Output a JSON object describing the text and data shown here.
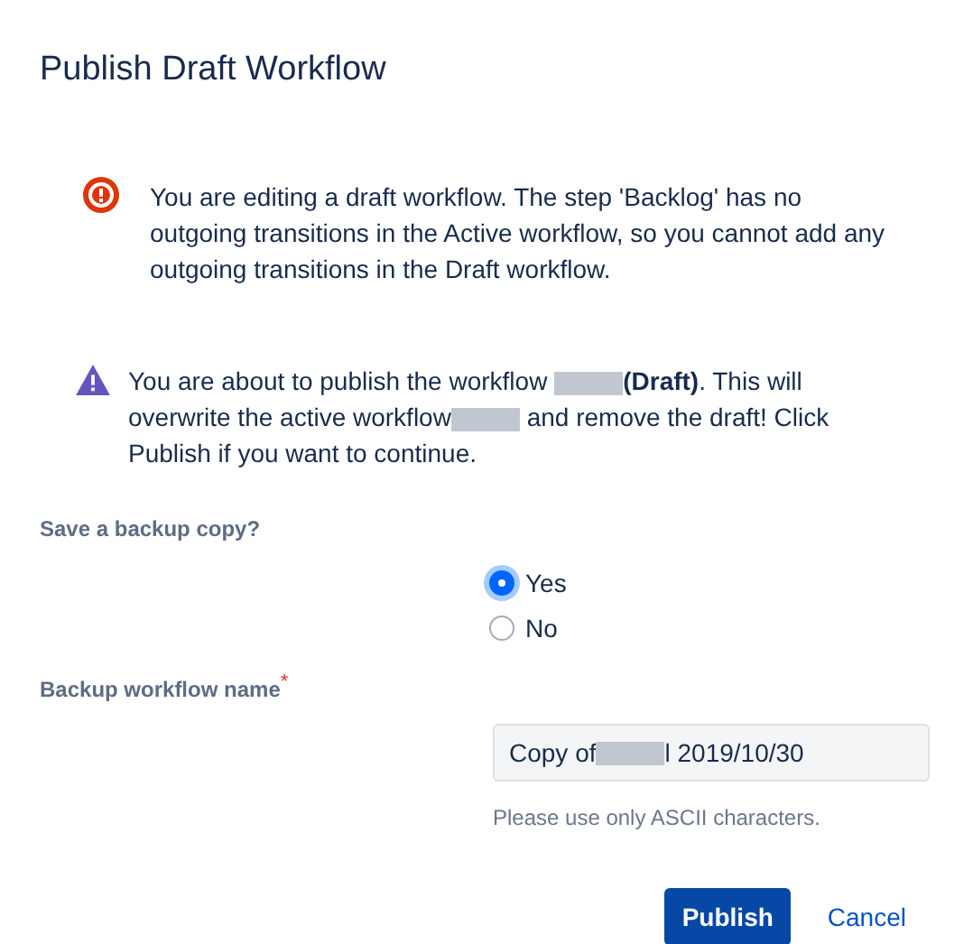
{
  "dialog": {
    "title": "Publish Draft Workflow"
  },
  "error_message": {
    "text": "You are editing a draft workflow. The step 'Backlog' has no outgoing transitions in the Active workflow, so you cannot add any outgoing transitions in the Draft workflow."
  },
  "warning_message": {
    "segments": [
      {
        "kind": "text",
        "text": "You are about to publish the workflow "
      },
      {
        "kind": "redacted"
      },
      {
        "kind": "text",
        "text": "**(Draft)**. This will overwrite the active workflow"
      },
      {
        "kind": "redacted"
      },
      {
        "kind": "text",
        "text": " and remove the draft! Click Publish if you want to continue."
      }
    ]
  },
  "backup": {
    "label": "Save a backup copy?",
    "options": [
      {
        "label": "Yes",
        "selected": true
      },
      {
        "label": "No",
        "selected": false
      }
    ]
  },
  "name_field": {
    "label": "Backup workflow name",
    "required_mark": "*",
    "value_segments": [
      {
        "kind": "text",
        "text": "Copy of "
      },
      {
        "kind": "redacted"
      },
      {
        "kind": "text",
        "text": "l 2019/10/30"
      }
    ],
    "help": "Please use only ASCII characters."
  },
  "buttons": [
    {
      "label": "Publish",
      "kind": "primary"
    },
    {
      "label": "Cancel",
      "kind": "link"
    }
  ]
}
